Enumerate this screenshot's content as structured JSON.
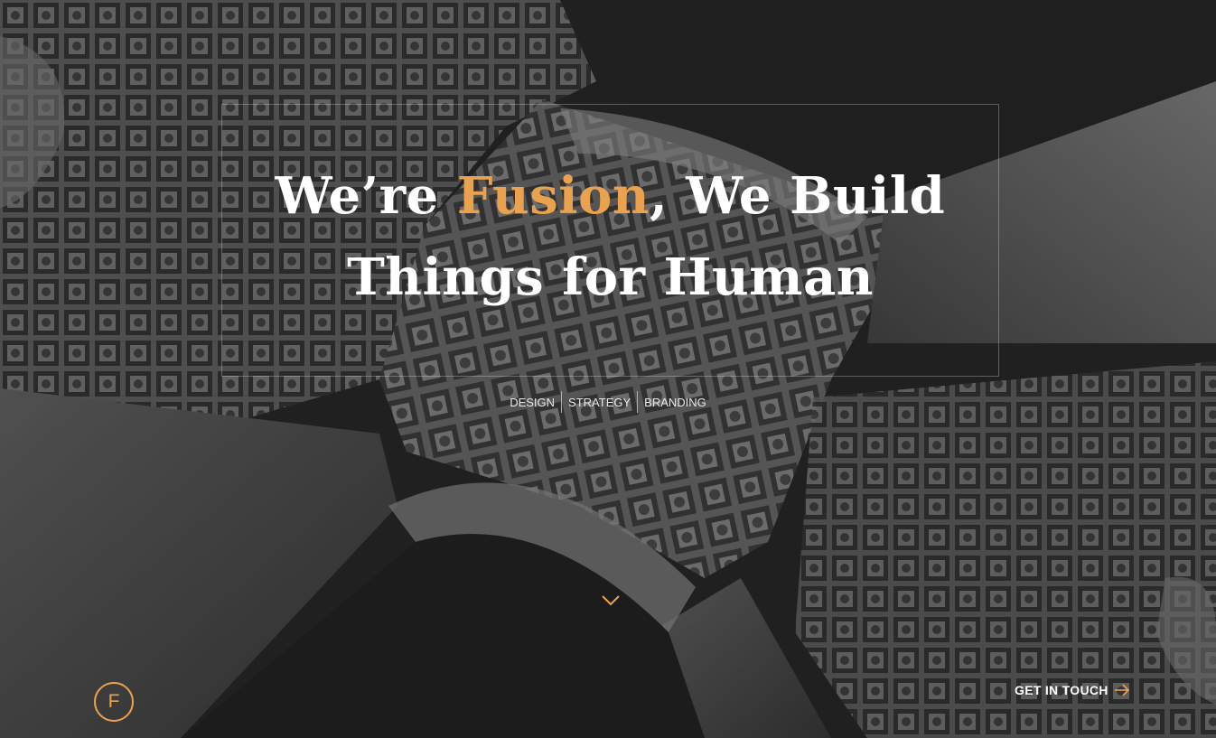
{
  "hero": {
    "headline_line1_prefix": "We’re ",
    "headline_accent": "Fusion",
    "headline_line1_suffix": ", We Build",
    "headline_line2": "Things for Human"
  },
  "tags": [
    "DESIGN",
    "STRATEGY",
    "BRANDING"
  ],
  "logo": {
    "letter": "F"
  },
  "cta": {
    "label": "GET IN TOUCH",
    "icon": "arrow-right-icon"
  },
  "scroll": {
    "icon": "chevron-down-icon"
  },
  "colors": {
    "accent": "#eaa24f",
    "background": "#2b2b2b",
    "text": "#ffffff"
  }
}
